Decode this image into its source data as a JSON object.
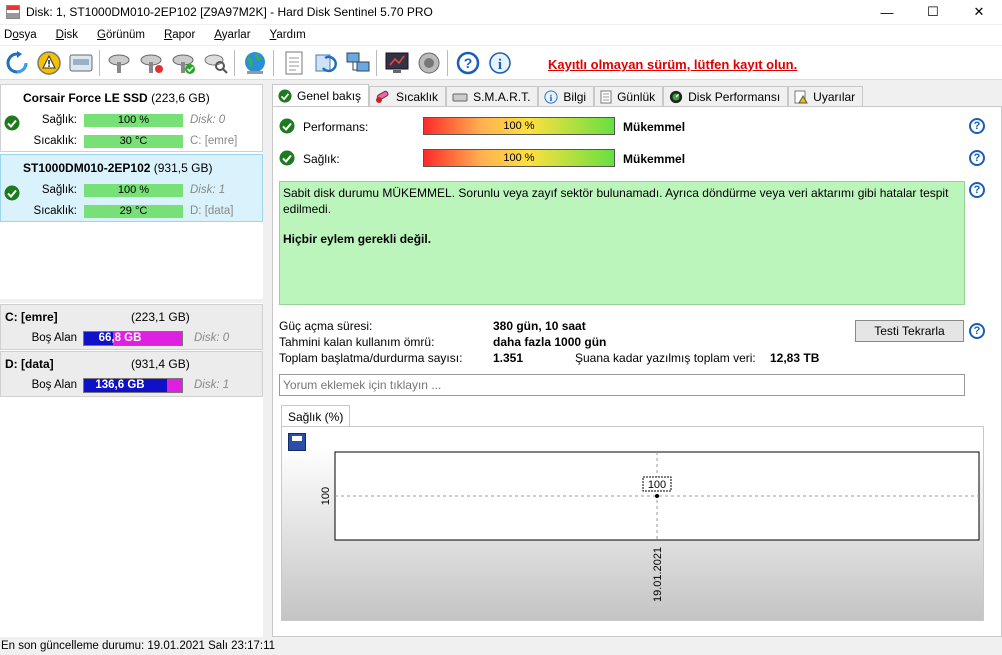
{
  "window": {
    "title": "Disk: 1, ST1000DM010-2EP102 [Z9A97M2K]  -  Hard Disk Sentinel 5.70 PRO",
    "minimize": "—",
    "maximize": "☐",
    "close": "✕"
  },
  "menu": [
    "Dosya",
    "Disk",
    "Görünüm",
    "Rapor",
    "Ayarlar",
    "Yardım"
  ],
  "menu_accel": [
    "o",
    "D",
    "G",
    "R",
    "A",
    "Y"
  ],
  "toolbar": {
    "icons": [
      "refresh-icon",
      "warning-icon",
      "disk-drive-icon",
      "disk-probe-icon",
      "disk-probe-icon",
      "disk-check-icon",
      "disk-search-icon",
      "globe-icon",
      "document-icon",
      "sync-icon",
      "network-icon",
      "monitor-icon",
      "speaker-icon",
      "help-icon",
      "info-icon"
    ],
    "register_text": "Kayıtlı olmayan sürüm, lütfen kayıt olun."
  },
  "disks": [
    {
      "name": "Corsair Force LE SSD",
      "size": "(223,6 GB)",
      "health_label": "Sağlık:",
      "health": "100 %",
      "health_value": 100,
      "temp_label": "Sıcaklık:",
      "temp": "30 °C",
      "disk_info": "Disk: 0",
      "vol_info": "C: [emre]",
      "selected": false
    },
    {
      "name": "ST1000DM010-2EP102",
      "size": "(931,5 GB)",
      "health_label": "Sağlık:",
      "health": "100 %",
      "health_value": 100,
      "temp_label": "Sıcaklık:",
      "temp": "29 °C",
      "disk_info": "Disk: 1",
      "vol_info": "D: [data]",
      "selected": true
    }
  ],
  "volumes": [
    {
      "name": "C: [emre]",
      "size": "(223,1 GB)",
      "free_label": "Boş Alan",
      "free": "66,8 GB",
      "free_fraction": 0.3,
      "disk": "Disk: 0"
    },
    {
      "name": "D: [data]",
      "size": "(931,4 GB)",
      "free_label": "Boş Alan",
      "free": "136,6 GB",
      "free_fraction": 0.85,
      "disk": "Disk: 1"
    }
  ],
  "tabs": [
    "Genel bakış",
    "Sıcaklık",
    "S.M.A.R.T.",
    "Bilgi",
    "Günlük",
    "Disk Performansı",
    "Uyarılar"
  ],
  "overview": {
    "performance_label": "Performans:",
    "performance_value": "100 %",
    "performance_status": "Mükemmel",
    "health_label": "Sağlık:",
    "health_value": "100 %",
    "health_status": "Mükemmel",
    "message": "Sabit disk durumu MÜKEMMEL. Sorunlu veya zayıf sektör bulunamadı. Ayrıca döndürme veya veri aktarımı gibi hatalar tespit edilmedi.",
    "message_bold": "Hiçbir eylem gerekli değil.",
    "power_on_label": "Güç açma süresi:",
    "power_on_value": "380 gün, 10 saat",
    "lifetime_label": "Tahmini kalan kullanım ömrü:",
    "lifetime_value": "daha fazla 1000 gün",
    "start_stop_label": "Toplam başlatma/durdurma sayısı:",
    "start_stop_value": "1.351",
    "written_label": "Şuana kadar yazılmış toplam veri:",
    "written_value": "12,83 TB",
    "retest_button": "Testi Tekrarla",
    "comment_placeholder": "Yorum eklemek için tıklayın ...",
    "help": "?"
  },
  "health_chart": {
    "tab": "Sağlık (%)"
  },
  "chart_data": {
    "type": "line",
    "x": [
      "19.01.2021"
    ],
    "series": [
      {
        "values": [
          100
        ]
      }
    ],
    "yticks": [
      "100"
    ],
    "data_labels": [
      "100"
    ],
    "grid": true
  },
  "status": {
    "text": "En son güncelleme durumu: 19.01.2021 Salı 23:17:11"
  },
  "colors": {
    "register_link": "#e00000",
    "good_bar": "#77e077",
    "message_bg": "#bbf5bb",
    "free_bar": "#1010c8",
    "used_bar": "#e020e0",
    "selected_disk_bg": "#d9f2fb"
  }
}
